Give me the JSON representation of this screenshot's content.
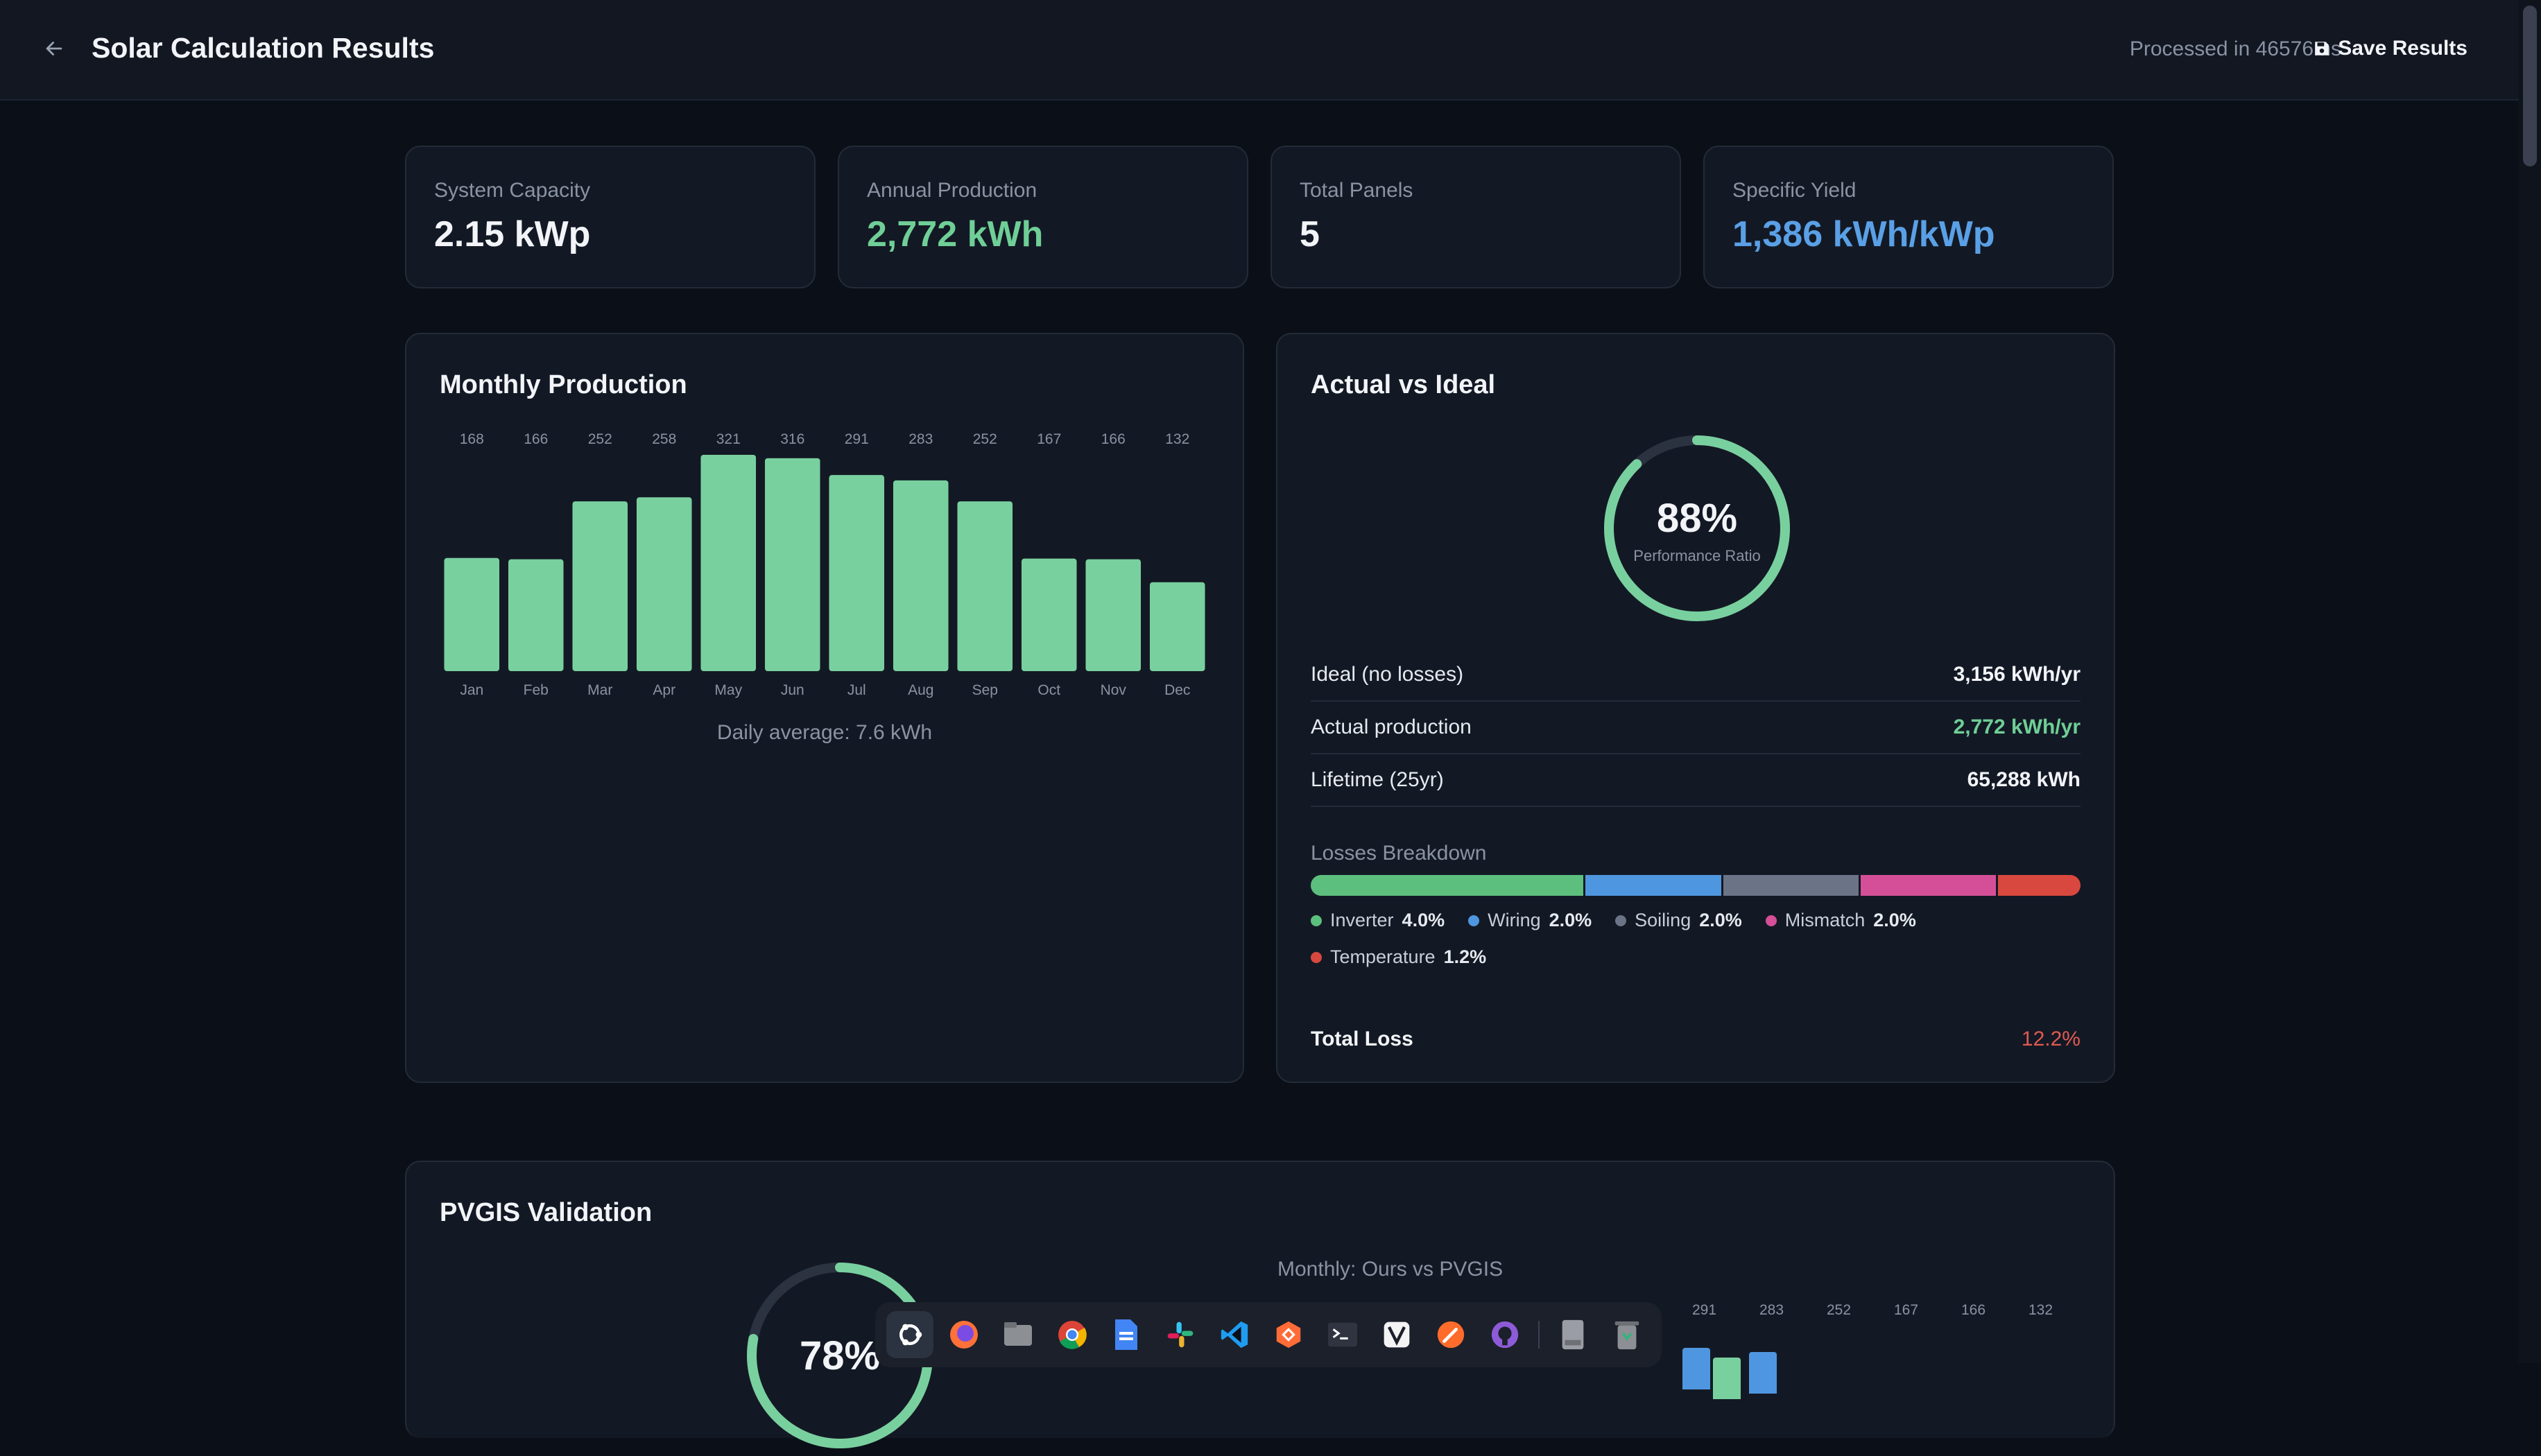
{
  "header": {
    "title": "Solar Calculation Results",
    "processed": "Processed in 46576ms",
    "save_label": "Save Results"
  },
  "stats": [
    {
      "label": "System Capacity",
      "value": "2.15 kWp",
      "color": "#f2f4f8"
    },
    {
      "label": "Annual Production",
      "value": "2,772 kWh",
      "color": "#6fcf97"
    },
    {
      "label": "Total Panels",
      "value": "5",
      "color": "#f2f4f8"
    },
    {
      "label": "Specific Yield",
      "value": "1,386 kWh/kWp",
      "color": "#5aa0e6"
    }
  ],
  "monthly": {
    "title": "Monthly Production",
    "daily_average": "Daily average: 7.6 kWh"
  },
  "chart_data": [
    {
      "type": "bar",
      "title": "Monthly Production",
      "categories": [
        "Jan",
        "Feb",
        "Mar",
        "Apr",
        "May",
        "Jun",
        "Jul",
        "Aug",
        "Sep",
        "Oct",
        "Nov",
        "Dec"
      ],
      "values": [
        168,
        166,
        252,
        258,
        321,
        316,
        291,
        283,
        252,
        167,
        166,
        132
      ],
      "value_labels": [
        "168",
        "166",
        "252",
        "258",
        "321",
        "316",
        "291",
        "283",
        "252",
        "167",
        "166",
        "132"
      ],
      "ylim": [
        0,
        321
      ],
      "color": "#79d09f",
      "grid": false
    }
  ],
  "actual_vs_ideal": {
    "title": "Actual vs Ideal",
    "ratio_value": 88,
    "ratio_text": "88%",
    "ratio_label": "Performance Ratio",
    "rows": [
      {
        "label": "Ideal (no losses)",
        "value": "3,156 kWh/yr",
        "color": "#f2f4f8"
      },
      {
        "label": "Actual production",
        "value": "2,772 kWh/yr",
        "color": "#6fcf97"
      },
      {
        "label": "Lifetime (25yr)",
        "value": "65,288 kWh",
        "color": "#f2f4f8"
      }
    ],
    "losses_title": "Losses Breakdown",
    "losses": [
      {
        "name": "Inverter",
        "pct": "4.0%",
        "value": 4.0,
        "color": "#5cbf7d"
      },
      {
        "name": "Wiring",
        "pct": "2.0%",
        "value": 2.0,
        "color": "#4f96e0"
      },
      {
        "name": "Soiling",
        "pct": "2.0%",
        "value": 2.0,
        "color": "#6b7386"
      },
      {
        "name": "Mismatch",
        "pct": "2.0%",
        "value": 2.0,
        "color": "#d44f97"
      },
      {
        "name": "Temperature",
        "pct": "1.2%",
        "value": 1.2,
        "color": "#d9483f"
      }
    ],
    "total_loss_label": "Total Loss",
    "total_loss_value": "12.2%"
  },
  "pvgis": {
    "title": "PVGIS Validation",
    "ratio_text": "78%",
    "ratio_value": 78,
    "compare_title": "Monthly: Ours vs PVGIS",
    "visible_labels": [
      "291",
      "283",
      "252",
      "167",
      "166",
      "132"
    ]
  },
  "taskbar": {
    "icons": [
      "ubuntu-icon",
      "firefox-icon",
      "files-icon",
      "chrome-icon",
      "docs-icon",
      "slack-icon",
      "vscode-icon",
      "postman-icon",
      "terminal-icon",
      "vim-icon",
      "sketch-icon",
      "github-icon",
      "drive-icon",
      "trash-icon"
    ]
  }
}
